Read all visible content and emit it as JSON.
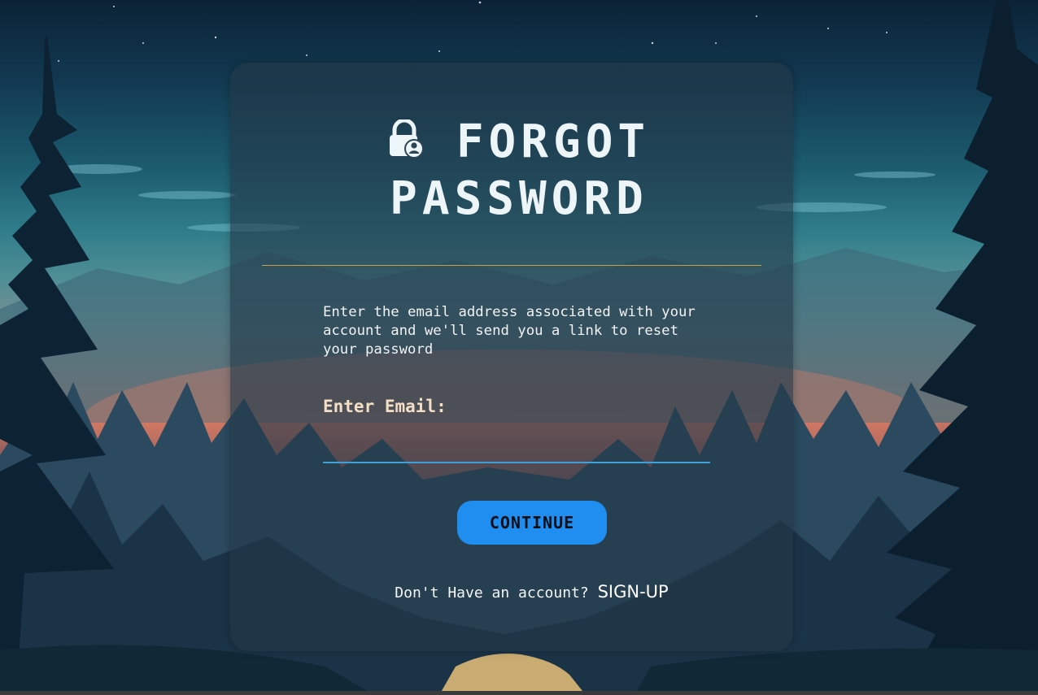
{
  "title": {
    "line1": "FORGOT",
    "line2": "PASSWORD",
    "icon": "lock-user-icon"
  },
  "description": "Enter the email address associated with your\naccount and we'll send you a link to reset\nyour password",
  "form": {
    "email_label": "Enter Email:",
    "email_value": "",
    "email_placeholder": "",
    "submit_label": "CONTINUE"
  },
  "footer": {
    "prompt": "Don't Have an account?",
    "link_label": "SIGN-UP"
  },
  "colors": {
    "accent": "#1f8ef0",
    "divider": "#c9a24a",
    "label": "#f4dfc6",
    "input_underline": "#3ea0d8"
  }
}
